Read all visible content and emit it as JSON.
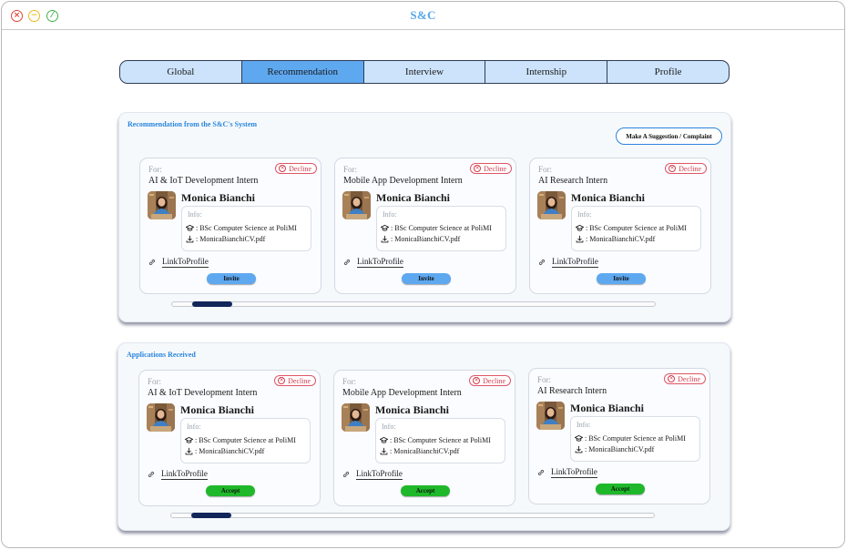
{
  "window": {
    "title": "S&C"
  },
  "tabs": [
    {
      "label": "Global",
      "active": false
    },
    {
      "label": "Recommendation",
      "active": true
    },
    {
      "label": "Interview",
      "active": false
    },
    {
      "label": "Internship",
      "active": false
    },
    {
      "label": "Profile",
      "active": false
    }
  ],
  "recommendation": {
    "title": "Recommendation from the S&C's System",
    "suggest_label": "Make A Suggestion / Complaint",
    "cards": [
      {
        "for_label": "For:",
        "role": "AI & IoT Development Intern",
        "decline_label": "Decline",
        "name": "Monica Bianchi",
        "info_label": "Info:",
        "education": ": BSc Computer Science at PoliMI",
        "cv": ": MonicaBianchiCV.pdf",
        "link": "LinkToProfile",
        "action": "Invite"
      },
      {
        "for_label": "For:",
        "role": "Mobile App Development Intern",
        "decline_label": "Decline",
        "name": "Monica Bianchi",
        "info_label": "Info:",
        "education": ": BSc Computer Science at PoliMI",
        "cv": ": MonicaBianchiCV.pdf",
        "link": "LinkToProfile",
        "action": "Invite"
      },
      {
        "for_label": "For:",
        "role": "AI Research Intern",
        "decline_label": "Decline",
        "name": "Monica Bianchi",
        "info_label": "Info:",
        "education": ": BSc Computer Science at PoliMI",
        "cv": ": MonicaBianchiCV.pdf",
        "link": "LinkToProfile",
        "action": "Invite"
      }
    ]
  },
  "applications": {
    "title": "Applications Received",
    "cards": [
      {
        "for_label": "For:",
        "role": "AI & IoT Development Intern",
        "decline_label": "Decline",
        "name": "Monica Bianchi",
        "info_label": "Info:",
        "education": ": BSc Computer Science at PoliMI",
        "cv": ": MonicaBianchiCV.pdf",
        "link": "LinkToProfile",
        "action": "Accept"
      },
      {
        "for_label": "For:",
        "role": "Mobile App Development Intern",
        "decline_label": "Decline",
        "name": "Monica Bianchi",
        "info_label": "Info:",
        "education": ": BSc Computer Science at PoliMI",
        "cv": ": MonicaBianchiCV.pdf",
        "link": "LinkToProfile",
        "action": "Accept"
      },
      {
        "for_label": "For:",
        "role": "AI Research Intern",
        "decline_label": "Decline",
        "name": "Monica Bianchi",
        "info_label": "Info:",
        "education": ": BSc Computer Science at PoliMI",
        "cv": ": MonicaBianchiCV.pdf",
        "link": "LinkToProfile",
        "action": "Accept"
      }
    ]
  },
  "colors": {
    "accent": "#5ea8f0",
    "title_blue": "#2a86dd",
    "decline_red": "#d23d4d",
    "accept_green": "#1fb82a",
    "scroll_thumb": "#12265a"
  }
}
